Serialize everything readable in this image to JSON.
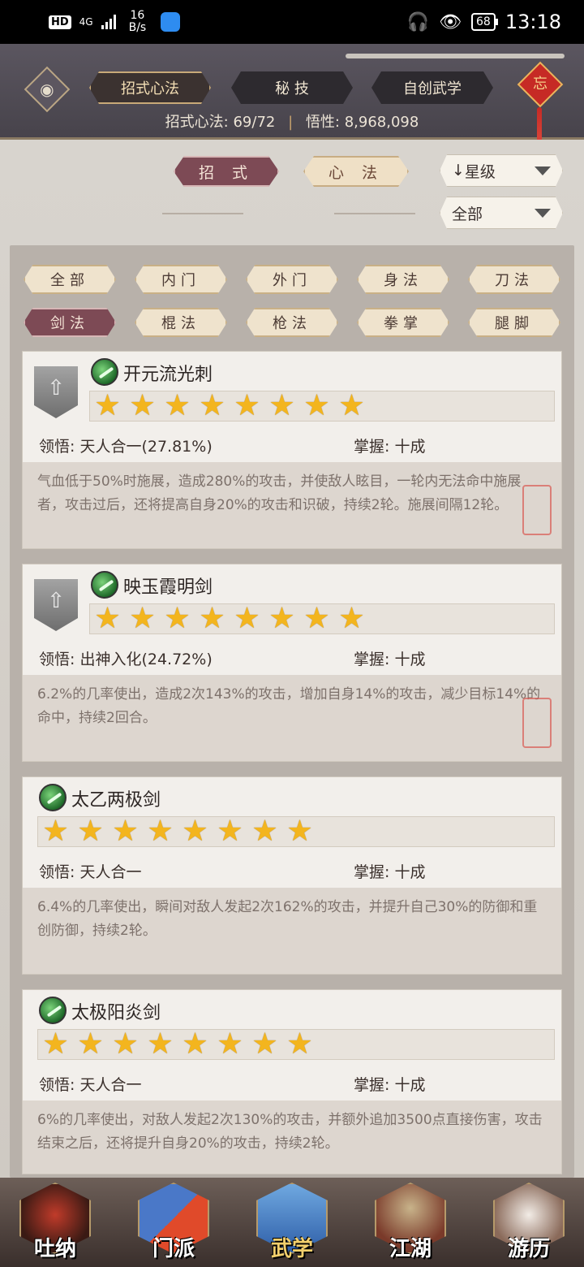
{
  "status_bar": {
    "hd": "HD",
    "network": "4G",
    "speed_value": "16",
    "speed_unit": "B/s",
    "battery": "68",
    "time": "13:18"
  },
  "header": {
    "tabs": [
      "招式心法",
      "秘 技",
      "自创武学"
    ],
    "charm_char": "忘",
    "stats_left_label": "招式心法:",
    "stats_left_value": "69/72",
    "stats_right_label": "悟性:",
    "stats_right_value": "8,968,098"
  },
  "subtabs": [
    "招 式",
    "心 法"
  ],
  "sort_dropdown": "星级",
  "filter_dropdown": "全部",
  "categories": [
    "全部",
    "内门",
    "外门",
    "身法",
    "刀法",
    "剑法",
    "棍法",
    "枪法",
    "拳掌",
    "腿脚"
  ],
  "active_category": "剑法",
  "skills": [
    {
      "name": "开元流光刺",
      "stars": 8,
      "comprehension_label": "领悟:",
      "comprehension": "天人合一(27.81%)",
      "mastery_label": "掌握:",
      "mastery": "十成",
      "description": "气血低于50%时施展，造成280%的攻击，并使敌人眩目，一轮内无法命中施展者，攻击过后，还将提高自身20%的攻击和识破，持续2轮。施展间隔12轮。",
      "has_badge": true
    },
    {
      "name": "映玉霞明剑",
      "stars": 8,
      "comprehension_label": "领悟:",
      "comprehension": "出神入化(24.72%)",
      "mastery_label": "掌握:",
      "mastery": "十成",
      "description": "6.2%的几率使出，造成2次143%的攻击，增加自身14%的攻击，减少目标14%的命中，持续2回合。",
      "has_badge": true
    },
    {
      "name": "太乙两极剑",
      "stars": 8,
      "comprehension_label": "领悟:",
      "comprehension": "天人合一",
      "mastery_label": "掌握:",
      "mastery": "十成",
      "description": "6.4%的几率使出，瞬间对敌人发起2次162%的攻击，并提升自己30%的防御和重创防御，持续2轮。",
      "has_badge": false
    },
    {
      "name": "太极阳炎剑",
      "stars": 8,
      "comprehension_label": "领悟:",
      "comprehension": "天人合一",
      "mastery_label": "掌握:",
      "mastery": "十成",
      "description": "6%的几率使出，对敌人发起2次130%的攻击，并额外追加3500点直接伤害，攻击结束之后，还将提升自身20%的攻击，持续2轮。",
      "has_badge": false
    }
  ],
  "bottom_nav": [
    "吐纳",
    "门派",
    "武学",
    "江湖",
    "游历"
  ],
  "active_nav": "武学",
  "colors": {
    "active_tab": "#7d4a55",
    "star": "#f3b51e",
    "seal": "#d95a53"
  }
}
